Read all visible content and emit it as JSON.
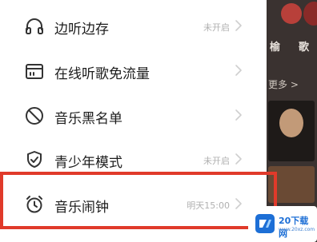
{
  "menu": {
    "items": [
      {
        "label": "边听边存",
        "status": "未开启",
        "icon": "headphones-icon"
      },
      {
        "label": "在线听歌免流量",
        "status": "",
        "icon": "sim-card-icon"
      },
      {
        "label": "音乐黑名单",
        "status": "",
        "icon": "block-icon"
      },
      {
        "label": "青少年模式",
        "status": "未开启",
        "icon": "shield-check-icon"
      },
      {
        "label": "音乐闹钟",
        "status": "明天15:00",
        "icon": "alarm-clock-icon"
      }
    ]
  },
  "background": {
    "label_1": "榆",
    "label_2": "歌",
    "more": "更多 >"
  },
  "watermark": {
    "brand": "20下载网",
    "url": "www.20xz.com"
  },
  "colors": {
    "highlight": "#e03a2a",
    "brand": "#1d6fd6",
    "text": "#1c1c1c",
    "muted": "#b0b0b0"
  }
}
